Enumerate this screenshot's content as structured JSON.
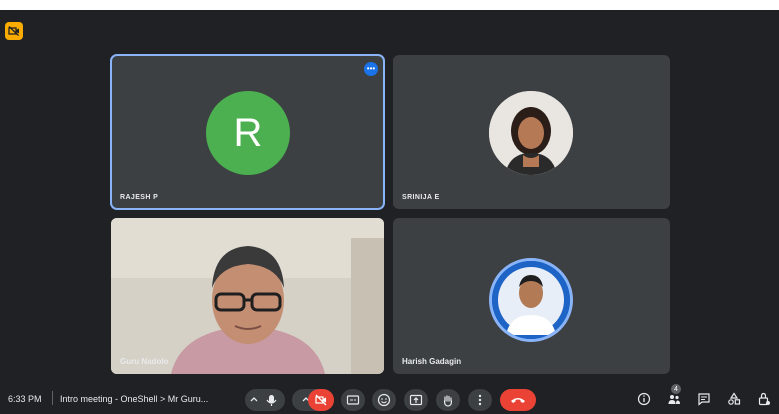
{
  "participants": [
    {
      "name": "RAJESH P",
      "avatar_letter": "R"
    },
    {
      "name": "SRINIJA E"
    },
    {
      "name": "Guru Nadolo"
    },
    {
      "name": "Harish Gadagin"
    }
  ],
  "toolbar": {
    "time": "6:33 PM",
    "meeting_title": "Intro meeting - OneShell > Mr Guru...",
    "participant_count": "4"
  },
  "icons": {
    "corner": "camera-off-icon",
    "more": "more-options-icon",
    "mic": "microphone-icon",
    "camera": "camera-off-icon",
    "captions": "captions-icon",
    "emoji": "emoji-icon",
    "present": "present-screen-icon",
    "raise_hand": "raise-hand-icon",
    "more_vert": "more-vert-icon",
    "leave": "leave-call-icon",
    "info": "info-icon",
    "people": "people-icon",
    "chat": "chat-icon",
    "activities": "activities-icon",
    "lock": "host-controls-icon"
  },
  "colors": {
    "background": "#202124",
    "tile": "#3c4043",
    "active_outline": "#8ab4f8",
    "leave": "#ea4335",
    "avatar_green": "#4caf50",
    "corner_badge": "#f9ab00"
  }
}
